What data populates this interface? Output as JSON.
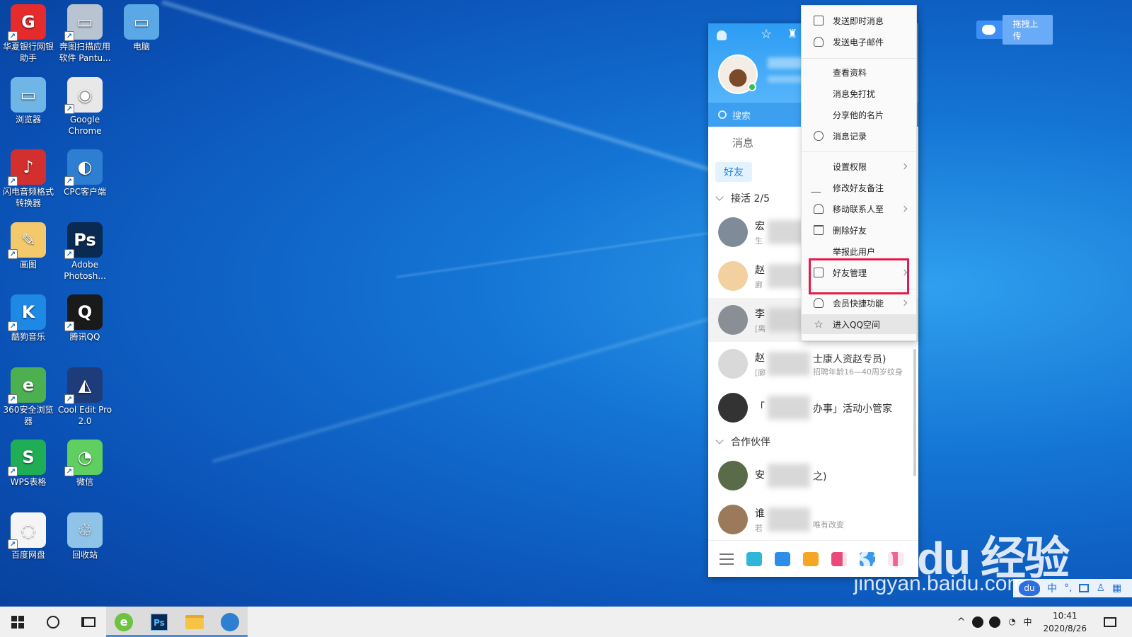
{
  "desktop": {
    "icons": [
      {
        "label": "华夏银行网银助手",
        "name": "hxb-bank-icon",
        "color": "#e52b2b",
        "glyph": "G"
      },
      {
        "label": "奔图扫描应用软件 Pantu...",
        "name": "pantum-scan-icon",
        "color": "#b8c4d2",
        "glyph": "▭"
      },
      {
        "label": "电脑",
        "name": "computer-icon",
        "color": "#5aa9e6",
        "glyph": "▭"
      },
      {
        "label": "浏览器",
        "name": "browser-icon",
        "color": "#6fb6e6",
        "glyph": "▭"
      },
      {
        "label": "Google Chrome",
        "name": "chrome-icon",
        "color": "#e8e8e8",
        "glyph": "◉"
      },
      {
        "label": "闪电音频格式转换器",
        "name": "audio-converter-icon",
        "color": "#d32f2f",
        "glyph": "♪"
      },
      {
        "label": "CPC客户端",
        "name": "cpc-client-icon",
        "color": "#2e7ed2",
        "glyph": "◐"
      },
      {
        "label": "画图",
        "name": "paint-icon",
        "color": "#f3c96b",
        "glyph": "✎"
      },
      {
        "label": "Adobe Photosh...",
        "name": "photoshop-icon",
        "color": "#0a2a52",
        "glyph": "Ps"
      },
      {
        "label": "酷狗音乐",
        "name": "kugou-icon",
        "color": "#1e88e5",
        "glyph": "K"
      },
      {
        "label": "腾讯QQ",
        "name": "qq-icon",
        "color": "#1a1a1a",
        "glyph": "Q"
      },
      {
        "label": "360安全浏览器",
        "name": "360-browser-icon",
        "color": "#4caf50",
        "glyph": "e"
      },
      {
        "label": "Cool Edit Pro 2.0",
        "name": "cool-edit-icon",
        "color": "#1f3c7a",
        "glyph": "◭"
      },
      {
        "label": "WPS表格",
        "name": "wps-sheet-icon",
        "color": "#1fae55",
        "glyph": "S"
      },
      {
        "label": "微信",
        "name": "wechat-icon",
        "color": "#5fcf5f",
        "glyph": "◔"
      },
      {
        "label": "百度网盘",
        "name": "baidu-netdisk-icon",
        "color": "#f5f5f5",
        "glyph": "◌"
      },
      {
        "label": "回收站",
        "name": "recycle-bin-icon",
        "color": "#8fc3e8",
        "glyph": "♲"
      }
    ],
    "shortcut_arrow": "↗"
  },
  "qq": {
    "search_placeholder": "搜索",
    "tab_messages": "消息",
    "subtab_friends": "好友",
    "group1_label": "接活 2/5",
    "group2_label": "合作伙伴",
    "contacts": [
      {
        "name": "宏",
        "status": "生"
      },
      {
        "name": "赵",
        "status": "廊"
      },
      {
        "name": "李",
        "status": "[离"
      },
      {
        "name": "赵",
        "status": "[廊",
        "extra": "士康人资赵专员)",
        "extra2": "招聘年龄16—40周岁纹身"
      },
      {
        "name": "「",
        "status": "",
        "extra": "办事」活动小管家"
      }
    ],
    "contacts2": [
      {
        "name": "安",
        "status": "",
        "extra": "之)"
      },
      {
        "name": "谁",
        "status": "若",
        "extra2": "唯有改变"
      }
    ]
  },
  "context_menu": {
    "items": [
      {
        "label": "发送即时消息",
        "icon": "message-icon"
      },
      {
        "label": "发送电子邮件",
        "icon": "mail-icon"
      },
      {
        "label": "查看资料",
        "icon": ""
      },
      {
        "label": "消息免打扰",
        "icon": ""
      },
      {
        "label": "分享他的名片",
        "icon": ""
      },
      {
        "label": "消息记录",
        "icon": "clock-icon"
      },
      {
        "label": "设置权限",
        "icon": "",
        "submenu": true
      },
      {
        "label": "修改好友备注",
        "icon": "pencil-icon"
      },
      {
        "label": "移动联系人至",
        "icon": "person-icon",
        "submenu": true
      },
      {
        "label": "删除好友",
        "icon": "trash-icon"
      },
      {
        "label": "举报此用户",
        "icon": ""
      },
      {
        "label": "好友管理",
        "icon": "card-icon",
        "submenu": true
      },
      {
        "label": "会员快捷功能",
        "icon": "bell-icon",
        "submenu": true
      },
      {
        "label": "进入QQ空间",
        "icon": "star-icon"
      }
    ],
    "highlight_color": "#e5194a"
  },
  "upload_button": {
    "label": "拖拽上传"
  },
  "watermark": {
    "big": "Bai du 经验",
    "small": "jingyan.baidu.com"
  },
  "ime": {
    "du": "du",
    "lang": "中"
  },
  "taskbar": {
    "time": "10:41",
    "date": "2020/8/26",
    "ime_indicator": "中",
    "tray_up": "^"
  }
}
